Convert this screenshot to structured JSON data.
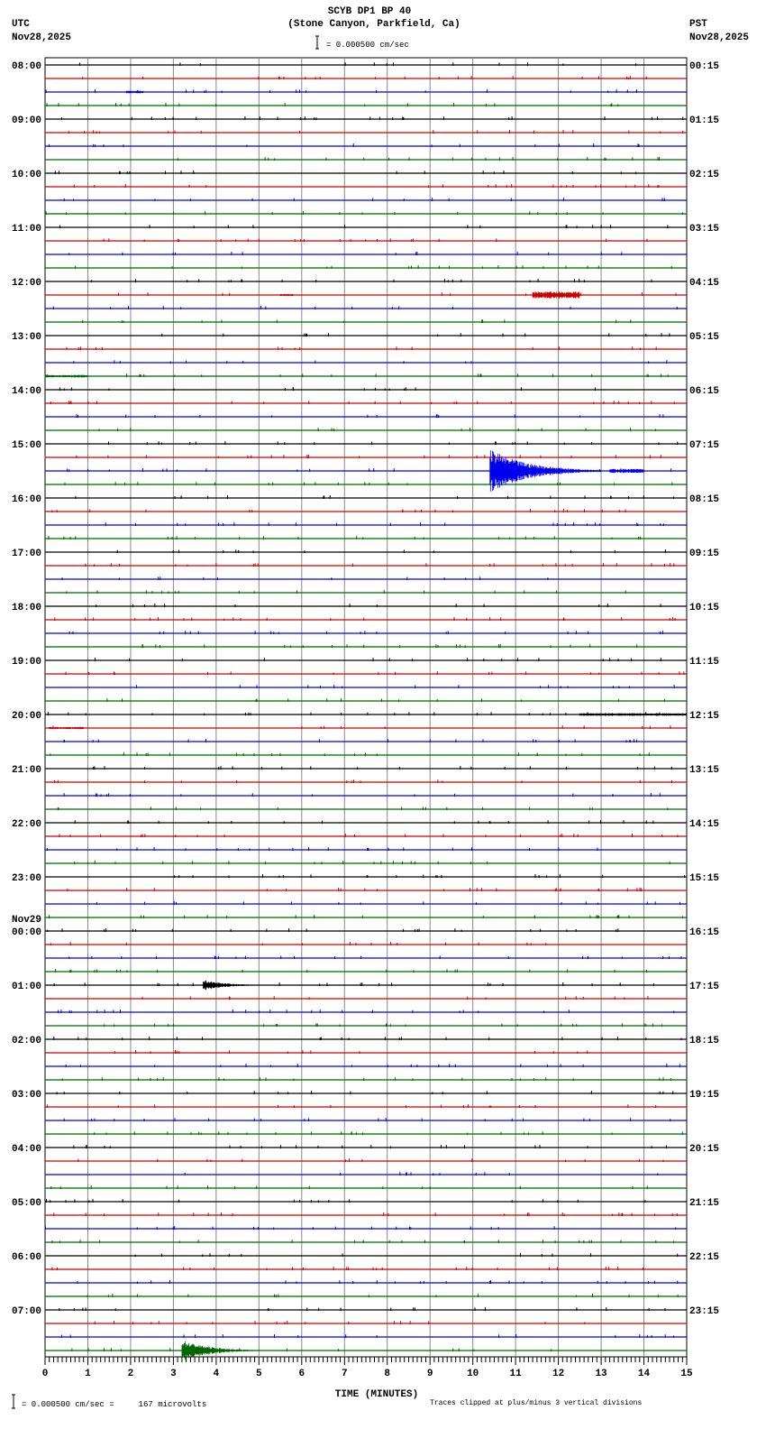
{
  "chart_data": {
    "type": "line",
    "title": "SCYB DP1 BP 40",
    "subtitle": "(Stone Canyon, Parkfield, Ca)",
    "left_timezone": "UTC",
    "left_date": "Nov28,2025",
    "right_timezone": "PST",
    "right_date": "Nov28,2025",
    "scale_label": "= 0.000500 cm/sec",
    "xlabel": "TIME (MINUTES)",
    "xlim": [
      0,
      15
    ],
    "x_ticks": [
      "0",
      "1",
      "2",
      "3",
      "4",
      "5",
      "6",
      "7",
      "8",
      "9",
      "10",
      "11",
      "12",
      "13",
      "14",
      "15"
    ],
    "grid": true,
    "traces_per_hour": 4,
    "trace_colors": [
      "#000000",
      "#cc0000",
      "#0000ee",
      "#006600"
    ],
    "left_labels": [
      "08:00",
      "09:00",
      "10:00",
      "11:00",
      "12:00",
      "13:00",
      "14:00",
      "15:00",
      "16:00",
      "17:00",
      "18:00",
      "19:00",
      "20:00",
      "21:00",
      "22:00",
      "23:00",
      "00:00",
      "01:00",
      "02:00",
      "03:00",
      "04:00",
      "05:00",
      "06:00",
      "07:00"
    ],
    "date_change_label": "Nov29",
    "right_labels": [
      "00:15",
      "01:15",
      "02:15",
      "03:15",
      "04:15",
      "05:15",
      "06:15",
      "07:15",
      "08:15",
      "09:15",
      "10:15",
      "11:15",
      "12:15",
      "13:15",
      "14:15",
      "15:15",
      "16:15",
      "17:15",
      "18:15",
      "19:15",
      "20:15",
      "21:15",
      "22:15",
      "23:15"
    ],
    "events": [
      {
        "trace": 2,
        "start_min": 1.9,
        "end_min": 2.3,
        "amplitude_div": 0.1
      },
      {
        "trace": 17,
        "start_min": 11.4,
        "end_min": 12.5,
        "amplitude_div": 0.25
      },
      {
        "trace": 17,
        "start_min": 5.5,
        "end_min": 5.8,
        "amplitude_div": 0.08
      },
      {
        "trace": 23,
        "start_min": 0.0,
        "end_min": 1.0,
        "amplitude_div": 0.1
      },
      {
        "trace": 30,
        "start_min": 10.4,
        "end_min": 13.0,
        "amplitude_div": 1.6,
        "decay": true
      },
      {
        "trace": 30,
        "start_min": 13.2,
        "end_min": 14.0,
        "amplitude_div": 0.15
      },
      {
        "trace": 48,
        "start_min": 12.5,
        "end_min": 15.0,
        "amplitude_div": 0.1
      },
      {
        "trace": 49,
        "start_min": 0.1,
        "end_min": 0.9,
        "amplitude_div": 0.08
      },
      {
        "trace": 68,
        "start_min": 3.7,
        "end_min": 5.2,
        "amplitude_div": 0.4,
        "decay": true
      },
      {
        "trace": 95,
        "start_min": 3.2,
        "end_min": 5.0,
        "amplitude_div": 0.8,
        "decay": true
      }
    ],
    "footer_scale": "= 0.000500 cm/sec =     167 microvolts",
    "footer_clip_note": "Traces clipped at plus/minus 3 vertical divisions"
  }
}
